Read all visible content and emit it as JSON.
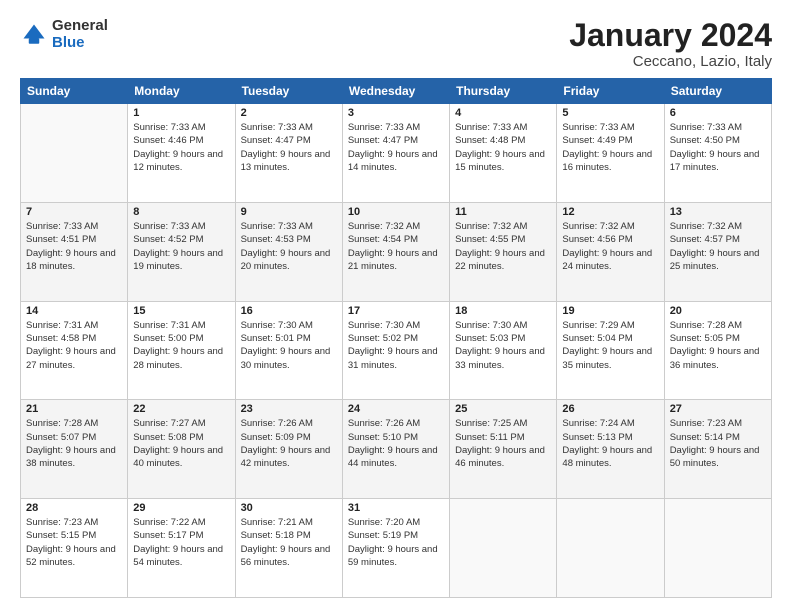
{
  "logo": {
    "general": "General",
    "blue": "Blue"
  },
  "title": "January 2024",
  "subtitle": "Ceccano, Lazio, Italy",
  "days_of_week": [
    "Sunday",
    "Monday",
    "Tuesday",
    "Wednesday",
    "Thursday",
    "Friday",
    "Saturday"
  ],
  "weeks": [
    [
      {
        "day": "",
        "empty": true
      },
      {
        "day": "1",
        "sunrise": "7:33 AM",
        "sunset": "4:46 PM",
        "daylight": "9 hours and 12 minutes."
      },
      {
        "day": "2",
        "sunrise": "7:33 AM",
        "sunset": "4:47 PM",
        "daylight": "9 hours and 13 minutes."
      },
      {
        "day": "3",
        "sunrise": "7:33 AM",
        "sunset": "4:47 PM",
        "daylight": "9 hours and 14 minutes."
      },
      {
        "day": "4",
        "sunrise": "7:33 AM",
        "sunset": "4:48 PM",
        "daylight": "9 hours and 15 minutes."
      },
      {
        "day": "5",
        "sunrise": "7:33 AM",
        "sunset": "4:49 PM",
        "daylight": "9 hours and 16 minutes."
      },
      {
        "day": "6",
        "sunrise": "7:33 AM",
        "sunset": "4:50 PM",
        "daylight": "9 hours and 17 minutes."
      }
    ],
    [
      {
        "day": "7",
        "sunrise": "7:33 AM",
        "sunset": "4:51 PM",
        "daylight": "9 hours and 18 minutes."
      },
      {
        "day": "8",
        "sunrise": "7:33 AM",
        "sunset": "4:52 PM",
        "daylight": "9 hours and 19 minutes."
      },
      {
        "day": "9",
        "sunrise": "7:33 AM",
        "sunset": "4:53 PM",
        "daylight": "9 hours and 20 minutes."
      },
      {
        "day": "10",
        "sunrise": "7:32 AM",
        "sunset": "4:54 PM",
        "daylight": "9 hours and 21 minutes."
      },
      {
        "day": "11",
        "sunrise": "7:32 AM",
        "sunset": "4:55 PM",
        "daylight": "9 hours and 22 minutes."
      },
      {
        "day": "12",
        "sunrise": "7:32 AM",
        "sunset": "4:56 PM",
        "daylight": "9 hours and 24 minutes."
      },
      {
        "day": "13",
        "sunrise": "7:32 AM",
        "sunset": "4:57 PM",
        "daylight": "9 hours and 25 minutes."
      }
    ],
    [
      {
        "day": "14",
        "sunrise": "7:31 AM",
        "sunset": "4:58 PM",
        "daylight": "9 hours and 27 minutes."
      },
      {
        "day": "15",
        "sunrise": "7:31 AM",
        "sunset": "5:00 PM",
        "daylight": "9 hours and 28 minutes."
      },
      {
        "day": "16",
        "sunrise": "7:30 AM",
        "sunset": "5:01 PM",
        "daylight": "9 hours and 30 minutes."
      },
      {
        "day": "17",
        "sunrise": "7:30 AM",
        "sunset": "5:02 PM",
        "daylight": "9 hours and 31 minutes."
      },
      {
        "day": "18",
        "sunrise": "7:30 AM",
        "sunset": "5:03 PM",
        "daylight": "9 hours and 33 minutes."
      },
      {
        "day": "19",
        "sunrise": "7:29 AM",
        "sunset": "5:04 PM",
        "daylight": "9 hours and 35 minutes."
      },
      {
        "day": "20",
        "sunrise": "7:28 AM",
        "sunset": "5:05 PM",
        "daylight": "9 hours and 36 minutes."
      }
    ],
    [
      {
        "day": "21",
        "sunrise": "7:28 AM",
        "sunset": "5:07 PM",
        "daylight": "9 hours and 38 minutes."
      },
      {
        "day": "22",
        "sunrise": "7:27 AM",
        "sunset": "5:08 PM",
        "daylight": "9 hours and 40 minutes."
      },
      {
        "day": "23",
        "sunrise": "7:26 AM",
        "sunset": "5:09 PM",
        "daylight": "9 hours and 42 minutes."
      },
      {
        "day": "24",
        "sunrise": "7:26 AM",
        "sunset": "5:10 PM",
        "daylight": "9 hours and 44 minutes."
      },
      {
        "day": "25",
        "sunrise": "7:25 AM",
        "sunset": "5:11 PM",
        "daylight": "9 hours and 46 minutes."
      },
      {
        "day": "26",
        "sunrise": "7:24 AM",
        "sunset": "5:13 PM",
        "daylight": "9 hours and 48 minutes."
      },
      {
        "day": "27",
        "sunrise": "7:23 AM",
        "sunset": "5:14 PM",
        "daylight": "9 hours and 50 minutes."
      }
    ],
    [
      {
        "day": "28",
        "sunrise": "7:23 AM",
        "sunset": "5:15 PM",
        "daylight": "9 hours and 52 minutes."
      },
      {
        "day": "29",
        "sunrise": "7:22 AM",
        "sunset": "5:17 PM",
        "daylight": "9 hours and 54 minutes."
      },
      {
        "day": "30",
        "sunrise": "7:21 AM",
        "sunset": "5:18 PM",
        "daylight": "9 hours and 56 minutes."
      },
      {
        "day": "31",
        "sunrise": "7:20 AM",
        "sunset": "5:19 PM",
        "daylight": "9 hours and 59 minutes."
      },
      {
        "day": "",
        "empty": true
      },
      {
        "day": "",
        "empty": true
      },
      {
        "day": "",
        "empty": true
      }
    ]
  ]
}
